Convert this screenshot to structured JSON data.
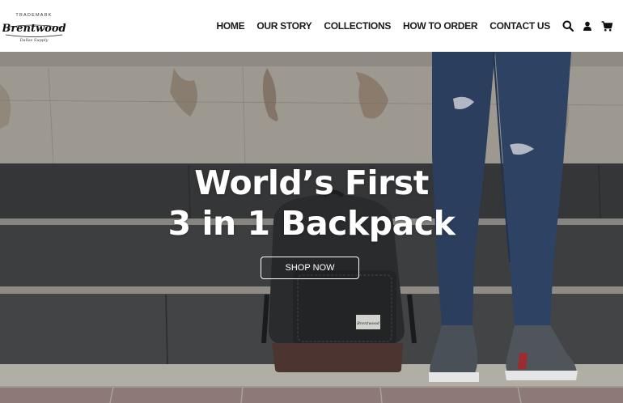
{
  "header": {
    "logo": {
      "top_text": "TRADEMARK",
      "brand": "Brentwood",
      "sub_text": "Dallas Supply"
    },
    "nav": [
      "HOME",
      "OUR STORY",
      "COLLECTIONS",
      "HOW TO ORDER",
      "CONTACT US"
    ],
    "icons": [
      "search-icon",
      "user-icon",
      "cart-icon"
    ]
  },
  "hero": {
    "title_line1": "World’s First",
    "title_line2": "3 in 1 Backpack",
    "button_label": "SHOP NOW",
    "patch_text": "Brentwood"
  },
  "colors": {
    "header_bg": "#ffffff",
    "nav_text": "#1a1a1a",
    "hero_text": "#ffffff",
    "wall": "#9c9890",
    "steps": "#3a3b3c",
    "jeans": "#2a3d5c"
  }
}
